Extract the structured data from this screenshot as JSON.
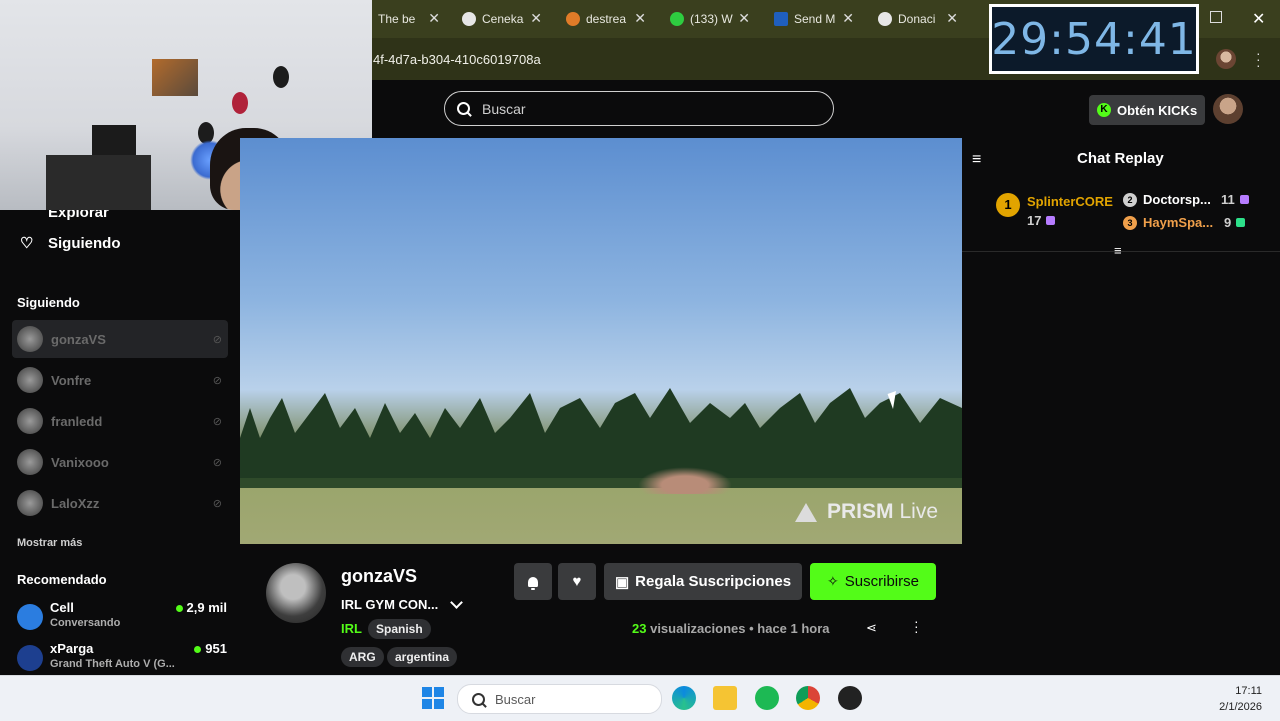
{
  "browser": {
    "tabs": [
      {
        "title": "The be"
      },
      {
        "title": "Ceneka"
      },
      {
        "title": "destrea"
      },
      {
        "title": "(133) W"
      },
      {
        "title": "Send M"
      },
      {
        "title": "Donaci"
      }
    ],
    "url": "4f-4d7a-b304-410c6019708a"
  },
  "timer": {
    "value": "29:54:41"
  },
  "header": {
    "search_placeholder": "Buscar",
    "kicks_label": "Obtén KICKs"
  },
  "sidebar": {
    "nav_partial": "Explorar",
    "nav_following": "Siguiendo",
    "following_heading": "Siguiendo",
    "following": [
      {
        "name": "gonzaVS"
      },
      {
        "name": "Vonfre"
      },
      {
        "name": "franledd"
      },
      {
        "name": "Vanixooo"
      },
      {
        "name": "LaloXzz"
      }
    ],
    "show_more": "Mostrar más",
    "recommended_heading": "Recomendado",
    "recommended": [
      {
        "name": "Cell",
        "sub": "Conversando",
        "viewers": "2,9 mil"
      },
      {
        "name": "xParga",
        "sub": "Grand Theft Auto V (G...",
        "viewers": "951"
      }
    ]
  },
  "video": {
    "watermark_bold": "PRISM",
    "watermark_light": "Live"
  },
  "channel": {
    "name": "gonzaVS",
    "title": "IRL GYM CON...",
    "category": "IRL",
    "tags": [
      "Spanish",
      "ARG",
      "argentina"
    ],
    "gift_label": "Regala Suscripciones",
    "subscribe_label": "Suscribirse",
    "views_count": "23",
    "views_label": "visualizaciones",
    "time_ago": "hace 1 hora"
  },
  "chat": {
    "title": "Chat Replay",
    "leaderboard": [
      {
        "rank": "1",
        "name": "SplinterCORE",
        "count": "17",
        "color": "#e2a400"
      },
      {
        "rank": "2",
        "name": "Doctorsp...",
        "count": "11",
        "color": "#ffffff"
      },
      {
        "rank": "3",
        "name": "HaymSpa...",
        "count": "9",
        "color": "#f0a04b"
      }
    ]
  },
  "taskbar": {
    "search_placeholder": "Buscar",
    "time": "17:11",
    "date": "2/1/2026"
  },
  "colors": {
    "accent": "#53fc18",
    "bg": "#0b0b0c",
    "browser": "#3a3f1e"
  }
}
